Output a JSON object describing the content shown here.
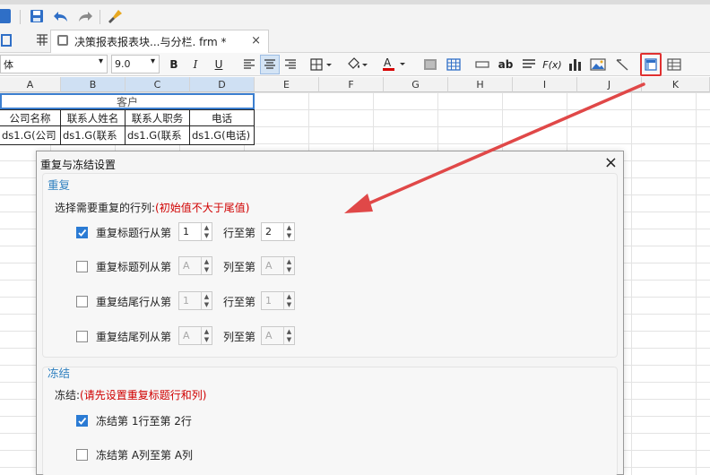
{
  "toolbar": {
    "font_name": "体",
    "font_size": "9.0",
    "bold": "B",
    "italic": "I",
    "underline": "U",
    "ab_label": "ab",
    "fx_label": "F(x)",
    "font_color": "#d60000"
  },
  "tab": {
    "title": "决策报表报表块...与分栏. frm *",
    "close": "×"
  },
  "columns": [
    "A",
    "B",
    "C",
    "D",
    "E",
    "F",
    "G",
    "H",
    "I",
    "J",
    "K"
  ],
  "sheet": {
    "title_cell": "客户",
    "header_row": [
      "公司名称",
      "联系人姓名",
      "联系人职务",
      "电话"
    ],
    "data_row": [
      "ds1.G(公司",
      "ds1.G(联系",
      "ds1.G(联系",
      "ds1.G(电话)"
    ]
  },
  "dialog": {
    "title": "重复与冻结设置",
    "close": "×",
    "repeat_section": {
      "title": "重复",
      "hint_prefix": "选择需要重复的行列:",
      "hint_red": "(初始值不大于尾值)",
      "rows": [
        {
          "label": "重复标题行从第",
          "checked": true,
          "from": "1",
          "to_label": "行至第",
          "to": "2",
          "enabled": true
        },
        {
          "label": "重复标题列从第",
          "checked": false,
          "from": "A",
          "to_label": "列至第",
          "to": "A",
          "enabled": false
        },
        {
          "label": "重复结尾行从第",
          "checked": false,
          "from": "1",
          "to_label": "行至第",
          "to": "1",
          "enabled": false
        },
        {
          "label": "重复结尾列从第",
          "checked": false,
          "from": "A",
          "to_label": "列至第",
          "to": "A",
          "enabled": false
        }
      ]
    },
    "freeze_section": {
      "title": "冻结",
      "hint_prefix": "冻结:",
      "hint_red": "(请先设置重复标题行和列)",
      "rows": [
        {
          "label": "冻结第 1行至第 2行",
          "checked": true
        },
        {
          "label": "冻结第 A列至第 A列",
          "checked": false
        }
      ]
    }
  },
  "colors": {
    "accent": "#2b7bd4",
    "highlight_box": "#e03030",
    "arrow": "#e04848",
    "section_title": "#2d7fbf",
    "red_text": "#d00000"
  }
}
